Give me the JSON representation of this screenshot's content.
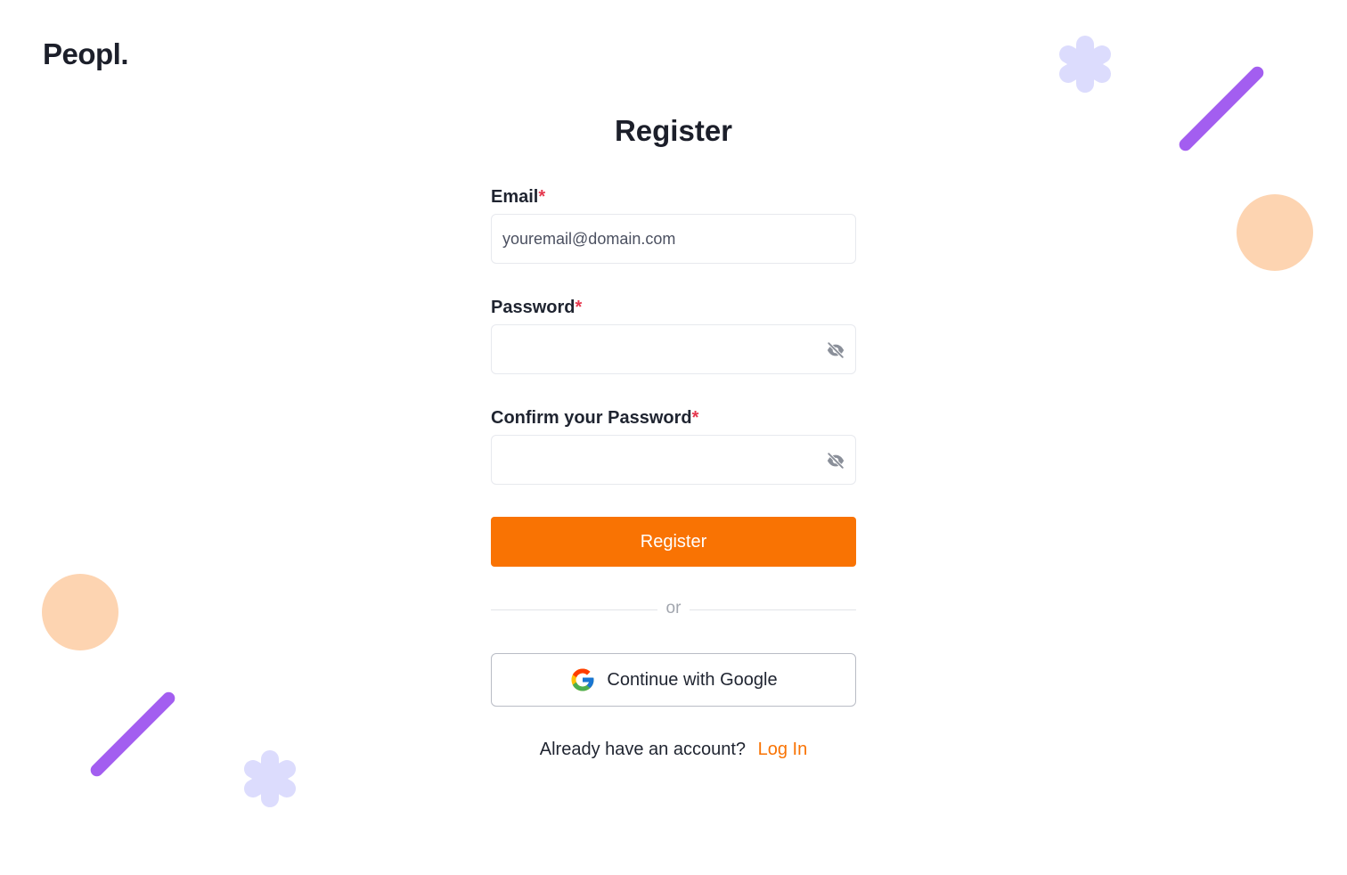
{
  "brand": {
    "logo_text": "Peopl."
  },
  "page": {
    "title": "Register"
  },
  "form": {
    "email": {
      "label": "Email",
      "required_mark": "*",
      "placeholder": "youremail@domain.com",
      "value": ""
    },
    "password": {
      "label": "Password",
      "required_mark": "*",
      "value": "",
      "toggle_icon": "eye-off-icon"
    },
    "confirm_password": {
      "label": "Confirm your Password",
      "required_mark": "*",
      "value": "",
      "toggle_icon": "eye-off-icon"
    },
    "submit_label": "Register",
    "divider_text": "or",
    "google_label": "Continue with Google"
  },
  "footer": {
    "prompt": "Already have an account?",
    "login_link": "Log In"
  },
  "colors": {
    "accent": "#f97303",
    "required": "#e5384e",
    "decor_purple": "#a35ef0",
    "decor_peach": "#fdd4b1",
    "decor_lavender": "#dcdcfd"
  }
}
